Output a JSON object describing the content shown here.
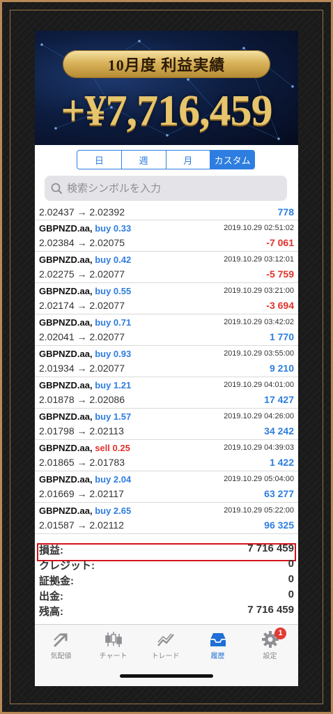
{
  "banner": {
    "title": "10月度 利益実績",
    "amount": "+¥7,716,459"
  },
  "period_tabs": [
    {
      "label": "日",
      "active": false
    },
    {
      "label": "週",
      "active": false
    },
    {
      "label": "月",
      "active": false
    },
    {
      "label": "カスタム",
      "active": true
    }
  ],
  "search": {
    "placeholder": "検索シンボルを入力"
  },
  "partial_row": {
    "prices": "2.02437 → 2.02392",
    "profit": "778"
  },
  "trades": [
    {
      "symbol": "GBPNZD.aa,",
      "side": "buy 0.33",
      "type": "buy",
      "time": "2019.10.29 02:51:02",
      "prices": "2.02384 → 2.02075",
      "profit": "-7 061",
      "profit_color": "#e0322b"
    },
    {
      "symbol": "GBPNZD.aa,",
      "side": "buy 0.42",
      "type": "buy",
      "time": "2019.10.29 03:12:01",
      "prices": "2.02275 → 2.02077",
      "profit": "-5 759",
      "profit_color": "#e0322b"
    },
    {
      "symbol": "GBPNZD.aa,",
      "side": "buy 0.55",
      "type": "buy",
      "time": "2019.10.29 03:21:00",
      "prices": "2.02174 → 2.02077",
      "profit": "-3 694",
      "profit_color": "#e0322b"
    },
    {
      "symbol": "GBPNZD.aa,",
      "side": "buy 0.71",
      "type": "buy",
      "time": "2019.10.29 03:42:02",
      "prices": "2.02041 → 2.02077",
      "profit": "1 770",
      "profit_color": "#2e7de0"
    },
    {
      "symbol": "GBPNZD.aa,",
      "side": "buy 0.93",
      "type": "buy",
      "time": "2019.10.29 03:55:00",
      "prices": "2.01934 → 2.02077",
      "profit": "9 210",
      "profit_color": "#2e7de0"
    },
    {
      "symbol": "GBPNZD.aa,",
      "side": "buy 1.21",
      "type": "buy",
      "time": "2019.10.29 04:01:00",
      "prices": "2.01878 → 2.02086",
      "profit": "17 427",
      "profit_color": "#2e7de0"
    },
    {
      "symbol": "GBPNZD.aa,",
      "side": "buy 1.57",
      "type": "buy",
      "time": "2019.10.29 04:26:00",
      "prices": "2.01798 → 2.02113",
      "profit": "34 242",
      "profit_color": "#2e7de0"
    },
    {
      "symbol": "GBPNZD.aa,",
      "side": "sell 0.25",
      "type": "sell",
      "time": "2019.10.29 04:39:03",
      "prices": "2.01865 → 2.01783",
      "profit": "1 422",
      "profit_color": "#2e7de0"
    },
    {
      "symbol": "GBPNZD.aa,",
      "side": "buy 2.04",
      "type": "buy",
      "time": "2019.10.29 05:04:00",
      "prices": "2.01669 → 2.02117",
      "profit": "63 277",
      "profit_color": "#2e7de0"
    },
    {
      "symbol": "GBPNZD.aa,",
      "side": "buy 2.65",
      "type": "buy",
      "time": "2019.10.29 05:22:00",
      "prices": "2.01587 → 2.02112",
      "profit": "96 325",
      "profit_color": "#2e7de0"
    }
  ],
  "summary": [
    {
      "label": "損益:",
      "value": "7 716 459"
    },
    {
      "label": "クレジット:",
      "value": "0"
    },
    {
      "label": "証拠金:",
      "value": "0"
    },
    {
      "label": "出金:",
      "value": "0"
    },
    {
      "label": "残高:",
      "value": "7 716 459"
    }
  ],
  "tabbar": [
    {
      "label": "気配値",
      "icon": "quotes-arrow-icon",
      "active": false
    },
    {
      "label": "チャート",
      "icon": "candlestick-chart-icon",
      "active": false
    },
    {
      "label": "トレード",
      "icon": "trade-line-icon",
      "active": false
    },
    {
      "label": "履歴",
      "icon": "history-inbox-icon",
      "active": true
    },
    {
      "label": "設定",
      "icon": "gear-icon",
      "active": false,
      "badge": "1"
    }
  ],
  "colors": {
    "buy": "#2e7de0",
    "sell": "#e0322b",
    "highlight_border": "#d3141a",
    "gold": "#e7c56d"
  }
}
